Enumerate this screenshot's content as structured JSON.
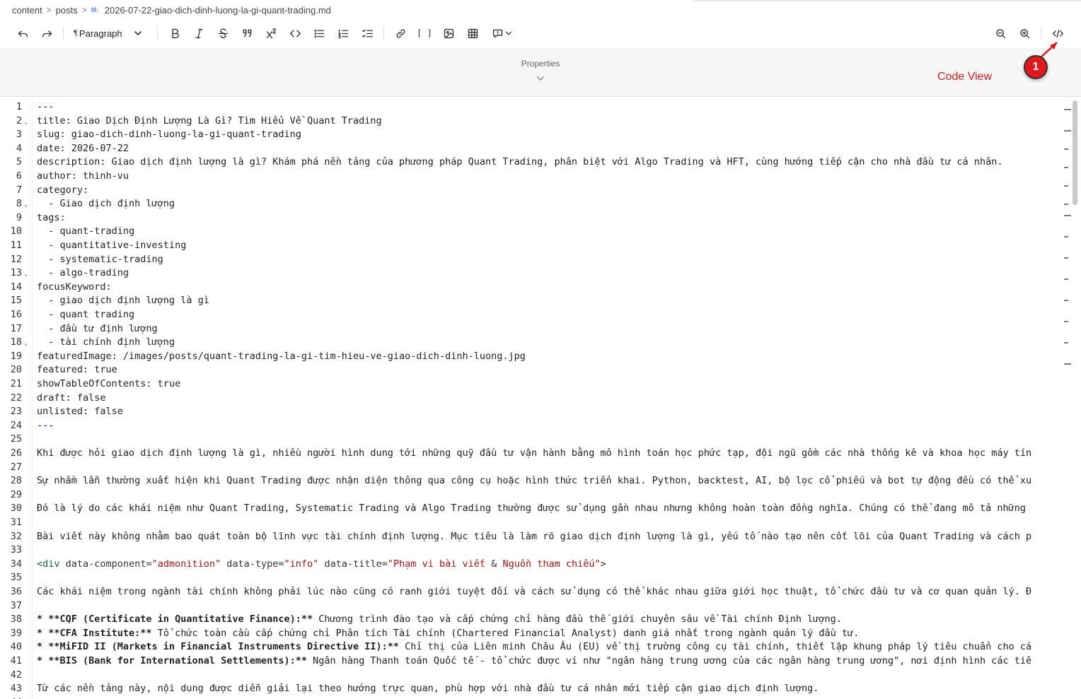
{
  "breadcrumb": {
    "items": [
      "content",
      "posts"
    ],
    "file_badge": "M↓",
    "file_name": "2026-07-22-giao-dich-dinh-luong-la-gi-quant-trading.md"
  },
  "toolbar": {
    "paragraph_label": "Paragraph",
    "pilcrow": "¶",
    "bracket_label": "[ ]",
    "icons": [
      "undo-icon",
      "redo-icon",
      "bold-icon",
      "italic-icon",
      "strikethrough-icon",
      "quote-icon",
      "superscript-icon",
      "inline-code-icon",
      "bullet-list-icon",
      "numbered-list-icon",
      "task-list-icon",
      "link-icon",
      "wikilink-icon",
      "image-icon",
      "table-icon",
      "callout-icon",
      "zoom-out-icon",
      "zoom-in-icon",
      "code-view-icon"
    ]
  },
  "properties": {
    "label": "Properties"
  },
  "annotation": {
    "label": "Code View",
    "step": "1"
  },
  "colors": {
    "annotation_red": "#e0181d",
    "frontmatter_dash": "#0000ff",
    "html_tag": "#116644",
    "html_string": "#a31515"
  },
  "editor": {
    "lines": [
      {
        "n": "1",
        "t": "---"
      },
      {
        "n": "2",
        "t": "title: Giao Dịch Định Lượng Là Gì? Tìm Hiểu Về Quant Trading"
      },
      {
        "n": "3",
        "t": "slug: giao-dich-dinh-luong-la-gi-quant-trading"
      },
      {
        "n": "4",
        "t": "date: 2026-07-22"
      },
      {
        "n": "5",
        "t": "description: Giao dịch định lượng là gì? Khám phá nền tảng của phương pháp Quant Trading, phân biệt với Algo Trading và HFT, cùng hướng tiếp cận cho nhà đầu tư cá nhân."
      },
      {
        "n": "6",
        "t": "author: thinh-vu"
      },
      {
        "n": "7",
        "t": "category:"
      },
      {
        "n": "8",
        "t": "  - Giao dịch định lượng"
      },
      {
        "n": "9",
        "t": "tags:"
      },
      {
        "n": "10",
        "t": "  - quant-trading"
      },
      {
        "n": "11",
        "t": "  - quantitative-investing"
      },
      {
        "n": "12",
        "t": "  - systematic-trading"
      },
      {
        "n": "13",
        "t": "  - algo-trading"
      },
      {
        "n": "14",
        "t": "focusKeyword:"
      },
      {
        "n": "15",
        "t": "  - giao dịch định lượng là gì"
      },
      {
        "n": "16",
        "t": "  - quant trading"
      },
      {
        "n": "17",
        "t": "  - đầu tư định lượng"
      },
      {
        "n": "18",
        "t": "  - tài chính định lượng"
      },
      {
        "n": "19",
        "t": "featuredImage: /images/posts/quant-trading-la-gi-tim-hieu-ve-giao-dich-dinh-luong.jpg"
      },
      {
        "n": "20",
        "t": "featured: true"
      },
      {
        "n": "21",
        "t": "showTableOfContents: true"
      },
      {
        "n": "22",
        "t": "draft: false"
      },
      {
        "n": "23",
        "t": "unlisted: false"
      },
      {
        "n": "24",
        "t": "---"
      },
      {
        "n": "25",
        "t": ""
      },
      {
        "n": "26",
        "t": "Khi được hỏi giao dịch định lượng là gì, nhiều người hình dung tới những quỹ đầu tư vận hành bằng mô hình toán học phức tạp, đội ngũ gồm các nhà thống kê và khoa học máy tín"
      },
      {
        "n": "27",
        "t": ""
      },
      {
        "n": "28",
        "t": "Sự nhầm lẫn thường xuất hiện khi Quant Trading được nhận diện thông qua công cụ hoặc hình thức triển khai. Python, backtest, AI, bộ lọc cổ phiếu và bot tự động đều có thể xu"
      },
      {
        "n": "29",
        "t": ""
      },
      {
        "n": "30",
        "t": "Đó là lý do các khái niệm như Quant Trading, Systematic Trading và Algo Trading thường được sử dụng gần nhau nhưng không hoàn toàn đồng nghĩa. Chúng có thể đang mô tả những"
      },
      {
        "n": "31",
        "t": ""
      },
      {
        "n": "32",
        "t": "Bài viết này không nhằm bao quát toàn bộ lĩnh vực tài chính định lượng. Mục tiêu là làm rõ giao dịch định lượng là gì, yếu tố nào tạo nên cốt lõi của Quant Trading và cách p"
      },
      {
        "n": "33",
        "t": ""
      },
      {
        "n": "34",
        "t": "",
        "html": {
          "open": "<",
          "tag": "div",
          "a1": " data-component=",
          "v1": "\"admonition\"",
          "a2": " data-type=",
          "v2": "\"info\"",
          "a3": " data-title=",
          "v3a": "\"Phạm vi bài viết ",
          "amp": "&",
          "v3b": " Nguồn tham chiếu\"",
          "close": ">"
        }
      },
      {
        "n": "35",
        "t": ""
      },
      {
        "n": "36",
        "t": "Các khái niệm trong ngành tài chính không phải lúc nào cũng có ranh giới tuyệt đối và cách sử dụng có thể khác nhau giữa giới học thuật, tổ chức đầu tư và cơ quan quản lý. Đ"
      },
      {
        "n": "37",
        "t": ""
      },
      {
        "n": "38",
        "b": "* **CQF (Certificate in Quantitative Finance):**",
        "t": " Chương trình đào tạo và cấp chứng chỉ hàng đầu thế giới chuyên sâu về Tài chính Định lượng."
      },
      {
        "n": "39",
        "b": "* **CFA Institute:**",
        "t": " Tổ chức toàn cầu cấp chứng chỉ Phân tích Tài chính (Chartered Financial Analyst) danh giá nhất trong ngành quản lý đầu tư."
      },
      {
        "n": "40",
        "b": "* **MiFID II (Markets in Financial Instruments Directive II):**",
        "t": " Chỉ thị của Liên minh Châu Âu (EU) về thị trường công cụ tài chính, thiết lập khung pháp lý tiêu chuẩn cho cá"
      },
      {
        "n": "41",
        "b": "* **BIS (Bank for International Settlements):**",
        "t": " Ngân hàng Thanh toán Quốc tế - tổ chức được ví như \"ngân hàng trung ương của các ngân hàng trung ương\", nơi định hình các tiê"
      },
      {
        "n": "42",
        "t": ""
      },
      {
        "n": "43",
        "t": "Từ các nền tảng này, nội dung được diễn giải lại theo hướng trực quan, phù hợp với nhà đầu tư cá nhân mới tiếp cận giao dịch định lượng."
      },
      {
        "n": "44",
        "t": ""
      }
    ]
  }
}
